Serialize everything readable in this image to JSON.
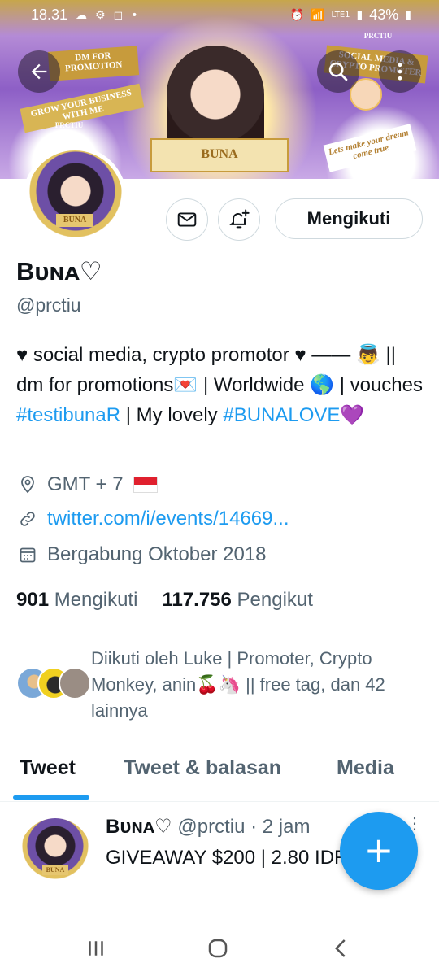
{
  "status_bar": {
    "time": "18.31",
    "battery": "43%",
    "network": "LTE1"
  },
  "banner": {
    "left_ribbon_1": "DM FOR PROMOTION",
    "left_ribbon_2": "GROW YOUR BUSINESS WITH ME",
    "right_ribbon_1": "SOCIAL MEDIA & CRYPTO PROMOTER",
    "right_ribbon_2": "Lets make your dream come true",
    "tag": "PRCTIU",
    "name_plate": "BUNA"
  },
  "avatar_label": "BUNA",
  "actions": {
    "follow_label": "Mengikuti"
  },
  "profile": {
    "display_name": "Bᴜɴᴀ♡",
    "handle": "@prctiu",
    "bio_part1": "♥ social media, crypto promotor ♥ —— ",
    "bio_emoji1": "👼",
    "bio_part2": " || dm for promotions",
    "bio_emoji2": "💌",
    "bio_part3": " | Worldwide ",
    "bio_emoji3": "🌎",
    "bio_part4": " | vouches ",
    "bio_link1": "#testibunaR",
    "bio_part5": " | My lovely ",
    "bio_link2": "#BUNALOVE",
    "bio_emoji4": "💜",
    "location": "GMT + 7",
    "url": "twitter.com/i/events/14669...",
    "joined": "Bergabung Oktober 2018"
  },
  "stats": {
    "following_count": "901",
    "following_label": "Mengikuti",
    "followers_count": "117.756",
    "followers_label": "Pengikut"
  },
  "followed_by": "Diikuti oleh Luke | Promoter, Crypto Monkey, anin🍒🦄 || free tag, dan 42 lainnya",
  "tabs": [
    "Tweet",
    "Tweet & balasan",
    "Media"
  ],
  "tweet": {
    "author_name": "Bᴜɴᴀ♡",
    "author_meta": " @prctiu · 2 jam",
    "body": "GIVEAWAY $200 | 2.80 IDR",
    "avatar_label": "BUNA"
  },
  "fab_label": "+"
}
